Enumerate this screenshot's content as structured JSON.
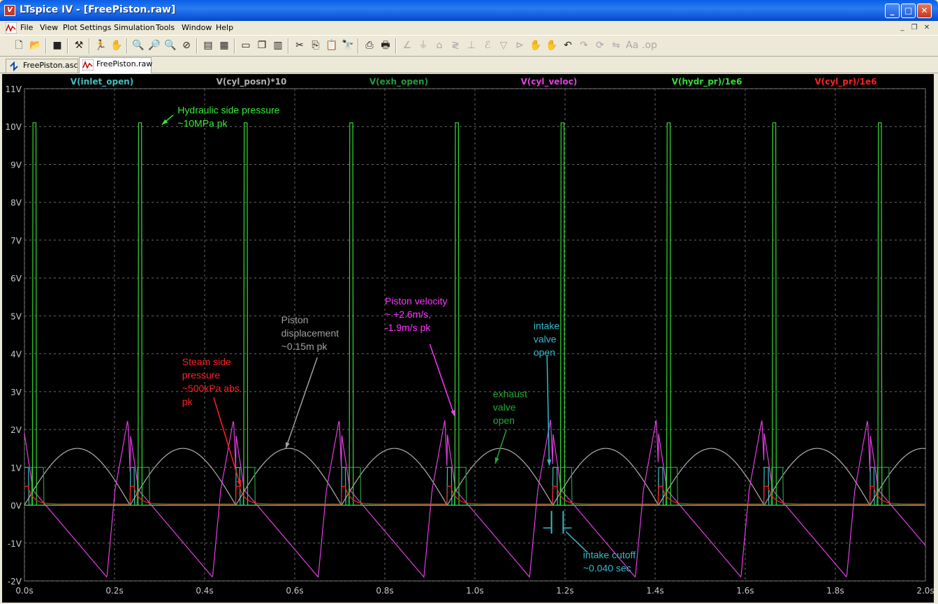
{
  "window": {
    "title": "LTspice IV - [FreePiston.raw]",
    "app_icon": "ltspice-logo-icon",
    "buttons": [
      "minimize-icon",
      "maximize-icon",
      "close-icon"
    ]
  },
  "menu": {
    "items": [
      "File",
      "View",
      "Plot Settings",
      "Simulation",
      "Tools",
      "Window",
      "Help"
    ]
  },
  "toolbar": {
    "icons": [
      "new-schematic-icon",
      "open-icon",
      "save-icon",
      "control-panel-icon",
      "run-icon",
      "halt-icon",
      "zoom-in-icon",
      "zoom-out-icon",
      "zoom-full-icon",
      "zoom-cancel-icon",
      "autorange-icon",
      "mark-icon",
      "tile-horizontal-icon",
      "cascade-icon",
      "tile-vertical-icon",
      "cut-icon",
      "copy-icon",
      "paste-icon",
      "find-icon",
      "print-preview-icon",
      "print-icon",
      "wire-icon",
      "ground-icon",
      "label-icon",
      "resistor-icon",
      "capacitor-icon",
      "inductor-icon",
      "diode-icon",
      "component-icon",
      "move-icon",
      "drag-icon",
      "undo-icon",
      "redo-icon",
      "rotate-icon",
      "mirror-icon",
      "text-icon",
      "spice-directive-icon"
    ]
  },
  "tabs": [
    {
      "label": "FreePiston.asc",
      "icon": "schematic-icon",
      "active": false
    },
    {
      "label": "FreePiston.raw",
      "icon": "waveform-icon",
      "active": true
    }
  ],
  "chart_data": {
    "type": "line",
    "xlim": [
      0.0,
      2.0
    ],
    "ylim": [
      -2,
      11
    ],
    "x_ticks": [
      "0.0s",
      "0.2s",
      "0.4s",
      "0.6s",
      "0.8s",
      "1.0s",
      "1.2s",
      "1.4s",
      "1.6s",
      "1.8s",
      "2.0s"
    ],
    "y_ticks": [
      "11V",
      "10V",
      "9V",
      "8V",
      "7V",
      "6V",
      "5V",
      "4V",
      "3V",
      "2V",
      "1V",
      "0V",
      "-1V",
      "-2V"
    ],
    "grid": true,
    "period": 0.2346,
    "series": [
      {
        "name": "V(inlet_open)",
        "color": "#3fbfbf",
        "shape": "pulse",
        "low": 0,
        "high": 1,
        "on_phase": [
          0.0,
          0.04
        ]
      },
      {
        "name": "V(cyl_posn)*10",
        "color": "#b0b0b0",
        "shape": "arch",
        "peak": 1.5
      },
      {
        "name": "V(exh_open)",
        "color": "#1f9c3c",
        "shape": "pulse",
        "low": 0,
        "high": 1,
        "on_phase": [
          0.07,
          0.18
        ]
      },
      {
        "name": "V(cyl_veloc)",
        "color": "#e040e0",
        "shape": "velocity",
        "max": 2.6,
        "min": -1.9
      },
      {
        "name": "V(hydr_pr)/1e6",
        "color": "#33dd33",
        "shape": "pulse",
        "low": 0,
        "high": 10.1,
        "on_phase": [
          0.077,
          0.11
        ]
      },
      {
        "name": "V(cyl_pr)/1e6",
        "color": "#ff2020",
        "shape": "decay",
        "peak": 0.5
      }
    ],
    "annotations": [
      {
        "text": [
          "Hydraulic side pressure",
          "~10MPa pk"
        ],
        "color": "#33ee33",
        "x": 0.34,
        "y": 10.35
      },
      {
        "text": [
          "Steam side",
          "pressure",
          "~500kPa abs",
          "   pk"
        ],
        "color": "#ff2020",
        "x": 0.35,
        "y": 3.7
      },
      {
        "text": [
          "Piston",
          "displacement",
          "~0.15m pk"
        ],
        "color": "#a0a0a0",
        "x": 0.57,
        "y": 4.8
      },
      {
        "text": [
          "Piston velocity",
          "~ +2.6m/s,",
          "  -1.9m/s pk"
        ],
        "color": "#ff33ff",
        "x": 0.8,
        "y": 5.3
      },
      {
        "text": [
          "intake",
          "valve",
          "open"
        ],
        "color": "#33bbcc",
        "x": 1.13,
        "y": 4.65
      },
      {
        "text": [
          "exhaust",
          "valve",
          "open"
        ],
        "color": "#22aa33",
        "x": 1.04,
        "y": 2.85
      },
      {
        "text": [
          "intake cutoff",
          "~0.040 sec"
        ],
        "color": "#33bbcc",
        "x": 1.24,
        "y": -1.4
      }
    ]
  }
}
